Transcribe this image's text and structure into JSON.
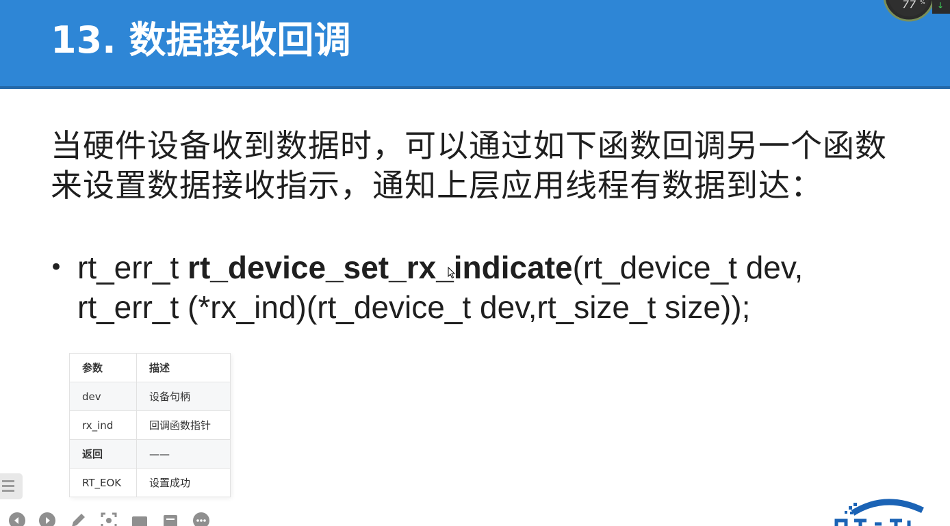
{
  "slide": {
    "title": "13. 数据接收回调",
    "intro_lines": [
      "当硬件设备收到数据时，可以通过如下函数回调另一个函数",
      "来设置数据接收指示，通知上层应用线程有数据到达："
    ],
    "signature": {
      "return_type": "rt_err_t ",
      "function_name": "rt_device_set_rx_indicate",
      "params_line1": "(rt_device_t dev,",
      "line2": "rt_err_t (*rx_ind)(rt_device_t dev,rt_size_t size));"
    }
  },
  "table": {
    "headers": [
      "参数",
      "描述"
    ],
    "rows": [
      [
        "dev",
        "设备句柄"
      ],
      [
        "rx_ind",
        "回调函数指针"
      ],
      [
        "返回",
        "——"
      ],
      [
        "RT_EOK",
        "设置成功"
      ]
    ]
  },
  "colors": {
    "header_bg": "#2e86d6",
    "header_border": "#2468a8",
    "logo_blue": "#1b63b5"
  },
  "toolbar": {
    "icons": [
      "prev-icon",
      "next-icon",
      "pen-icon",
      "screenshot-icon",
      "camera-icon",
      "document-icon",
      "more-icon"
    ]
  }
}
